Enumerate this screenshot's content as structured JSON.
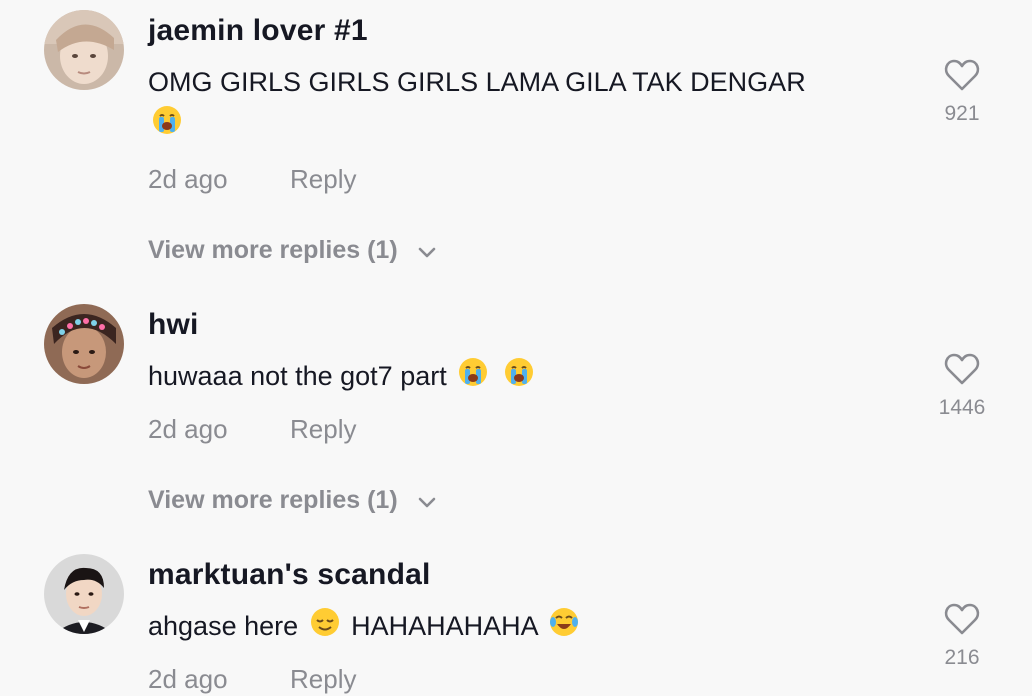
{
  "comments": [
    {
      "username": "jaemin lover #1",
      "text_line1": "OMG GIRLS GIRLS GIRLS LAMA GILA TAK DENGAR",
      "emoji_line2": "😭",
      "time": "2d ago",
      "reply_label": "Reply",
      "likes": "921",
      "view_more": "View more replies (1)",
      "avatar": "avatar-jaemin-lover"
    },
    {
      "username": "hwi",
      "text": "huwaaa not the got7 part",
      "emojis": [
        "😭",
        "😭"
      ],
      "time": "2d ago",
      "reply_label": "Reply",
      "likes": "1446",
      "view_more": "View more replies (1)",
      "avatar": "avatar-hwi"
    },
    {
      "username": "marktuan's scandal",
      "text_a": "ahgase here",
      "emoji_a": "😌",
      "text_b": "HAHAHAHAHA",
      "emoji_b": "😂",
      "time": "2d ago",
      "reply_label": "Reply",
      "likes": "216",
      "avatar": "avatar-marktuan"
    }
  ],
  "icons": {
    "like": "heart-outline-icon",
    "expand": "chevron-down-icon"
  },
  "colors": {
    "background": "#f8f8f8",
    "primary_text": "#161823",
    "secondary_text": "#8a8b91"
  }
}
